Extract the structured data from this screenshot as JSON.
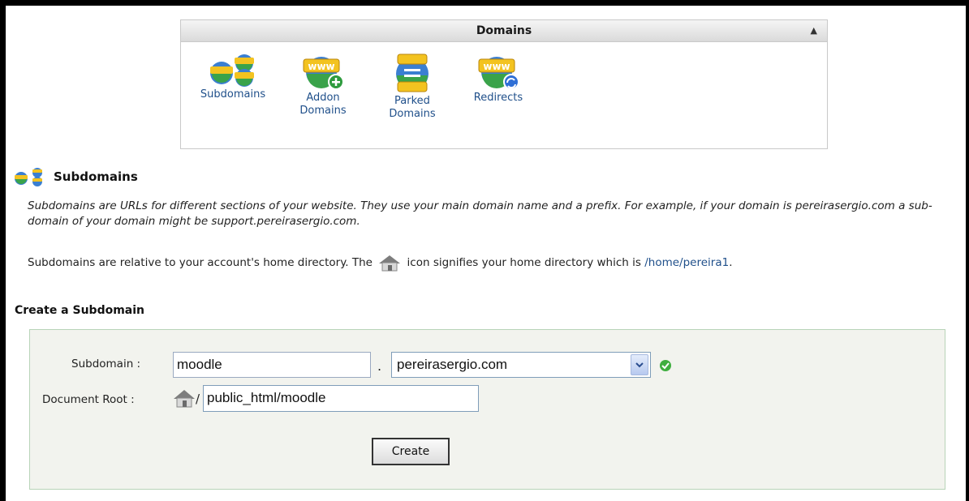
{
  "domains_panel": {
    "title": "Domains",
    "items": [
      {
        "label_line1": "Subdomains",
        "label_line2": ""
      },
      {
        "label_line1": "Addon",
        "label_line2": "Domains"
      },
      {
        "label_line1": "Parked",
        "label_line2": "Domains"
      },
      {
        "label_line1": "Redirects",
        "label_line2": ""
      }
    ],
    "icon_text": "www"
  },
  "subdomains": {
    "heading": "Subdomains",
    "description": "Subdomains are URLs for different sections of your website. They use your main domain name and a prefix. For example, if your domain is pereirasergio.com a sub-domain of your domain might be support.pereirasergio.com.",
    "home_note_before": "Subdomains are relative to your account's home directory. The",
    "home_note_after": "icon signifies your home directory which is",
    "home_path": "/home/pereira1",
    "home_note_end": "."
  },
  "create_form": {
    "heading": "Create a Subdomain",
    "subdomain_label": "Subdomain :",
    "subdomain_value": "moodle",
    "dot": ".",
    "domain_selected": "pereirasergio.com",
    "docroot_label": "Document Root :",
    "docroot_slash": "/",
    "docroot_value": "public_html/moodle",
    "create_button": "Create"
  },
  "colors": {
    "link": "#1f4f8a",
    "form_bg": "#f2f3ee",
    "valid_check": "#3fae3f"
  }
}
